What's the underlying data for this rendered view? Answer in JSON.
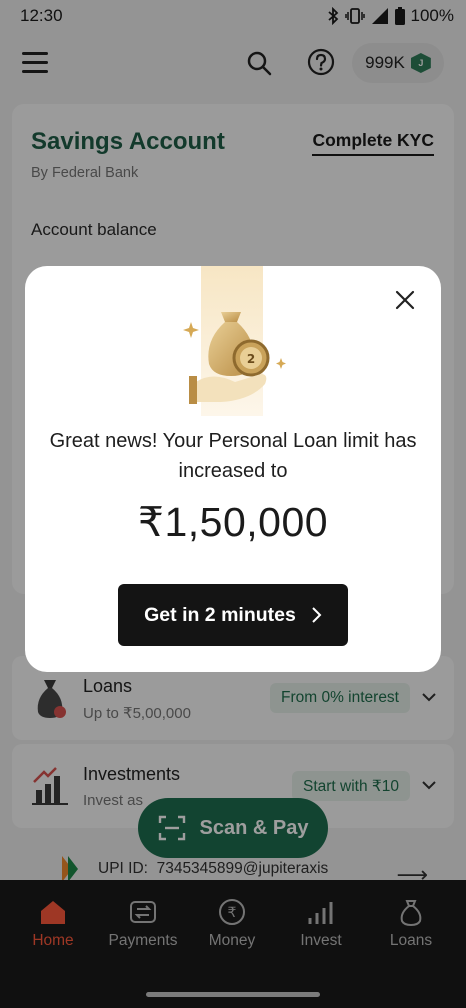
{
  "status_bar": {
    "time": "12:30",
    "battery": "100%",
    "icons": [
      "bluetooth-icon",
      "vibrate-icon",
      "signal-icon",
      "battery-icon"
    ]
  },
  "header": {
    "menu_icon": "hamburger-menu-icon",
    "search_icon": "search-icon",
    "help_icon": "help-icon",
    "points": "999K",
    "points_badge": "J"
  },
  "savings": {
    "title": "Savings Account",
    "subtitle": "By Federal Bank",
    "kyc_label": "Complete KYC",
    "balance_label": "Account balance"
  },
  "products": [
    {
      "title": "Loans",
      "subtitle": "Up to ₹5,00,000",
      "tag": "From 0% interest",
      "icon": "loan-bag-icon"
    },
    {
      "title": "Investments",
      "subtitle": "Invest as",
      "tag": "Start with ₹10",
      "icon": "investment-chart-icon"
    }
  ],
  "scan_pay": {
    "label": "Scan & Pay",
    "icon": "scan-icon"
  },
  "upi": {
    "label": "UPI ID:",
    "value": "7345345899@jupiteraxis",
    "arrow": "⟶"
  },
  "bottom_nav": [
    {
      "label": "Home",
      "icon": "home-icon",
      "active": true
    },
    {
      "label": "Payments",
      "icon": "payments-icon",
      "active": false
    },
    {
      "label": "Money",
      "icon": "money-icon",
      "active": false
    },
    {
      "label": "Invest",
      "icon": "invest-icon",
      "active": false
    },
    {
      "label": "Loans",
      "icon": "loans-icon",
      "active": false
    }
  ],
  "modal": {
    "message": "Great news! Your Personal Loan limit has increased to",
    "amount": "₹1,50,000",
    "cta_label": "Get in 2 minutes",
    "illustration_icon": "money-bag-hand-icon",
    "coin_number": "2"
  },
  "colors": {
    "brand_green": "#1f5e47",
    "accent_orange": "#ff5a3c",
    "cta_dark": "#141414",
    "gold": "#c9a25a"
  }
}
